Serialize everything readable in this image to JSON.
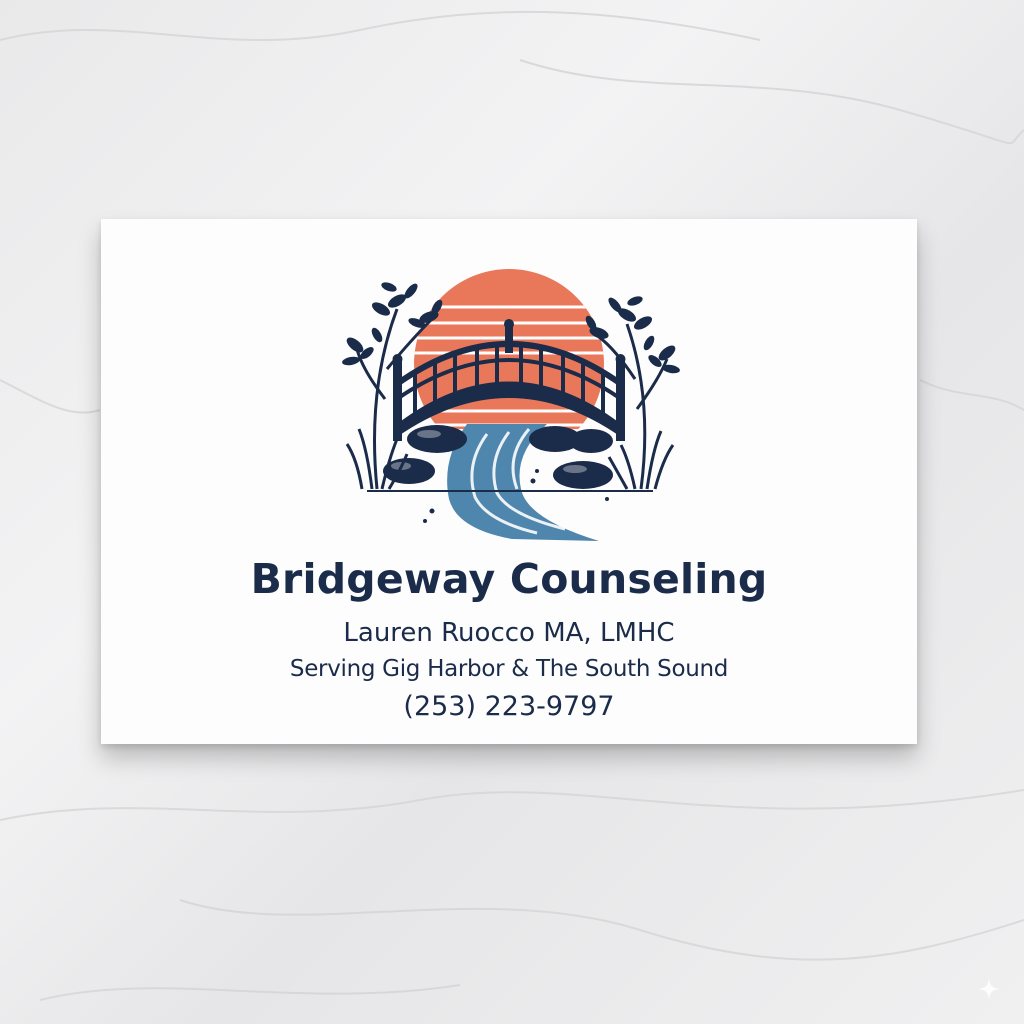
{
  "card": {
    "business_name": "Bridgeway Counseling",
    "therapist": "Lauren Ruocco MA, LMHC",
    "service_area": "Serving Gig Harbor & The South Sound",
    "phone": "(253) 223-9797"
  },
  "colors": {
    "navy": "#1b2b4a",
    "sun": "#e9785a",
    "river": "#4f86ad",
    "card": "#fdfdfd",
    "marble": "#ececed"
  },
  "icons": {
    "logo": "bridge-over-river-sunset-logo",
    "corner": "sparkle-icon"
  }
}
